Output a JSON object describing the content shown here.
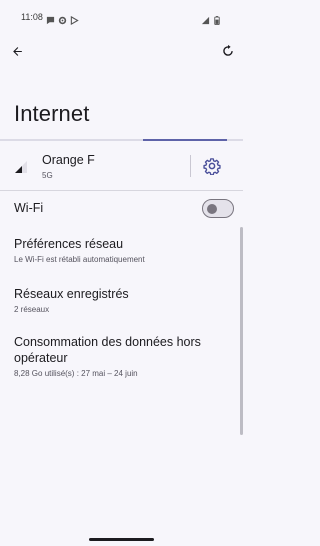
{
  "status_bar": {
    "time": "11:08",
    "left_icons": [
      "chat-bubble-icon",
      "gear-icon",
      "play-store-icon"
    ],
    "right_icons": [
      "signal-icon",
      "battery-icon"
    ]
  },
  "top_bar": {
    "back_icon": "arrow-left-icon",
    "refresh_icon": "refresh-icon"
  },
  "page": {
    "title": "Internet",
    "progress": 0.35
  },
  "carrier": {
    "name": "Orange F",
    "network": "5G",
    "settings_icon": "gear-icon"
  },
  "wifi": {
    "label": "Wi-Fi",
    "enabled": false
  },
  "items": [
    {
      "title": "Préférences réseau",
      "subtitle": "Le Wi-Fi est rétabli automatiquement"
    },
    {
      "title": "Réseaux enregistrés",
      "subtitle": "2 réseaux"
    },
    {
      "title": "Consommation des données hors opérateur",
      "subtitle": "8,28 Go utilisé(s) : 27 mai – 24 juin"
    }
  ],
  "colors": {
    "accent": "#5e63a8",
    "background": "#f7f6fb"
  }
}
